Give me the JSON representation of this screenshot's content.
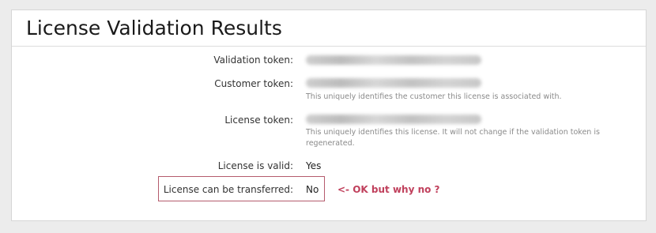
{
  "page": {
    "title": "License Validation Results"
  },
  "fields": {
    "validation_token": {
      "label": "Validation token:"
    },
    "customer_token": {
      "label": "Customer token:",
      "help": "This uniquely identifies the customer this license is associated with."
    },
    "license_token": {
      "label": "License token:",
      "help": "This uniquely identifies this license. It will not change if the validation token is regenerated."
    },
    "license_valid": {
      "label": "License is valid:",
      "value": "Yes"
    },
    "license_transferable": {
      "label": "License can be transferred:",
      "value": "No"
    }
  },
  "annotation": {
    "text": "<- OK but why no ?"
  },
  "colors": {
    "highlight_border": "#b55b6d",
    "annotation_text": "#c0405c"
  }
}
